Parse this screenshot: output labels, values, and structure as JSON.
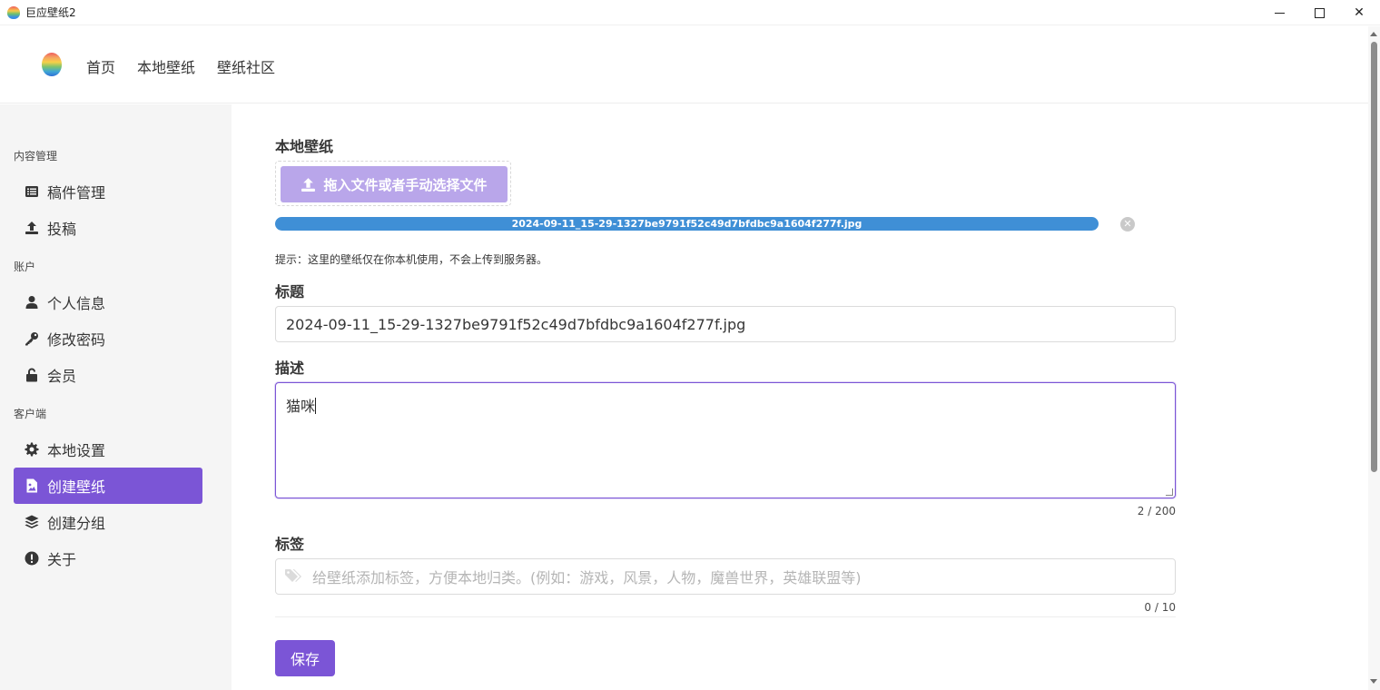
{
  "window": {
    "title": "巨应壁纸2"
  },
  "nav": {
    "items": [
      "首页",
      "本地壁纸",
      "壁纸社区"
    ]
  },
  "sidebar": {
    "sections": [
      {
        "label": "内容管理"
      },
      {
        "label": "账户"
      },
      {
        "label": "客户端"
      }
    ],
    "items": [
      {
        "label": "稿件管理",
        "icon": "list-icon"
      },
      {
        "label": "投稿",
        "icon": "upload-icon"
      },
      {
        "label": "个人信息",
        "icon": "user-icon"
      },
      {
        "label": "修改密码",
        "icon": "key-icon"
      },
      {
        "label": "会员",
        "icon": "unlock-icon"
      },
      {
        "label": "本地设置",
        "icon": "gear-icon"
      },
      {
        "label": "创建壁纸",
        "icon": "file-image-icon",
        "active": true
      },
      {
        "label": "创建分组",
        "icon": "layers-icon"
      },
      {
        "label": "关于",
        "icon": "info-icon"
      }
    ]
  },
  "form": {
    "section_title": "本地壁纸",
    "upload_label": "拖入文件或者手动选择文件",
    "upload_progress": 1.0,
    "file_name": "2024-09-11_15-29-1327be9791f52c49d7bfdbc9a1604f277f.jpg",
    "hint": "提示：这里的壁纸仅在你本机使用，不会上传到服务器。",
    "title_label": "标题",
    "title_value": "2024-09-11_15-29-1327be9791f52c49d7bfdbc9a1604f277f.jpg",
    "desc_label": "描述",
    "desc_value": "猫咪",
    "desc_counter": "2 / 200",
    "tags_label": "标签",
    "tags_placeholder": "给壁纸添加标签，方便本地归类。(例如：游戏，风景，人物，魔兽世界，英雄联盟等)",
    "tags_counter": "0 / 10",
    "save_label": "保存"
  },
  "colors": {
    "accent": "#7b55d6",
    "upload_button": "#b9a6ea",
    "progress": "#3f8fd6",
    "sidebar_bg": "#f5f5f5"
  }
}
